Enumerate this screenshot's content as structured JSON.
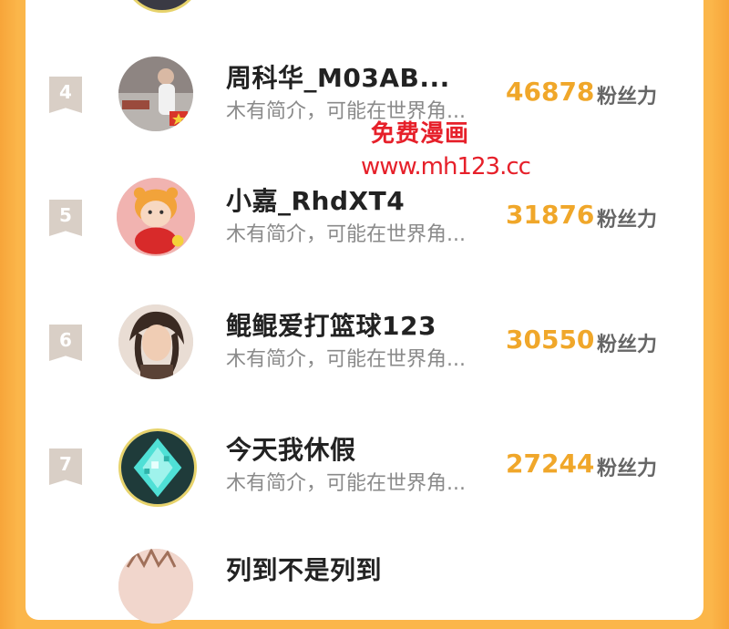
{
  "rows": [
    {
      "rank": "4",
      "name": "周科华_M03AB...",
      "bio": "木有简介，可能在世界角...",
      "count": "46878",
      "unit": "粉丝力"
    },
    {
      "rank": "5",
      "name": "小嘉_RhdXT4",
      "bio": "木有简介，可能在世界角...",
      "count": "31876",
      "unit": "粉丝力"
    },
    {
      "rank": "6",
      "name": "鲲鲲爱打篮球123",
      "bio": "木有简介，可能在世界角...",
      "count": "30550",
      "unit": "粉丝力"
    },
    {
      "rank": "7",
      "name": "今天我休假",
      "bio": "木有简介，可能在世界角...",
      "count": "27244",
      "unit": "粉丝力"
    },
    {
      "rank": "",
      "name": "列到不是列到",
      "bio": "",
      "count": "",
      "unit": ""
    }
  ],
  "watermark": {
    "title": "免费漫画",
    "url": "www.mh123.cc"
  },
  "colors": {
    "accent": "#f0a72a",
    "background_orange": "#fbb64a",
    "watermark_red": "#e6202a"
  }
}
